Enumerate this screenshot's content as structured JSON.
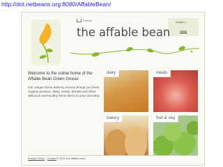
{
  "browser": {
    "url": "http://dot.netbeans.org:8080/AffableBean/"
  },
  "header": {
    "cart_text": "0 items",
    "title": "the affable bean",
    "languages": {
      "english": "english |",
      "czech": "česky"
    }
  },
  "welcome": {
    "heading": "Welcome to the online home of the Affable Bean Green Grocer.",
    "body": "Our unique home delivery service brings you fresh organic produce, dairy, meats, breads and other delicious and healthy items direct to your doorstep."
  },
  "categories": [
    {
      "label": "dairy"
    },
    {
      "label": "meats"
    },
    {
      "label": "bakery"
    },
    {
      "label": "fruit & veg"
    }
  ],
  "footer": {
    "privacy": "Privacy Policy",
    "sep1": "::",
    "contact": "Contact",
    "copyright": "© 2010 the affable bean"
  },
  "colors": {
    "url": "#1d1dd8",
    "accent_green": "#8ab52e",
    "bean_yellow": "#f4b32b"
  }
}
